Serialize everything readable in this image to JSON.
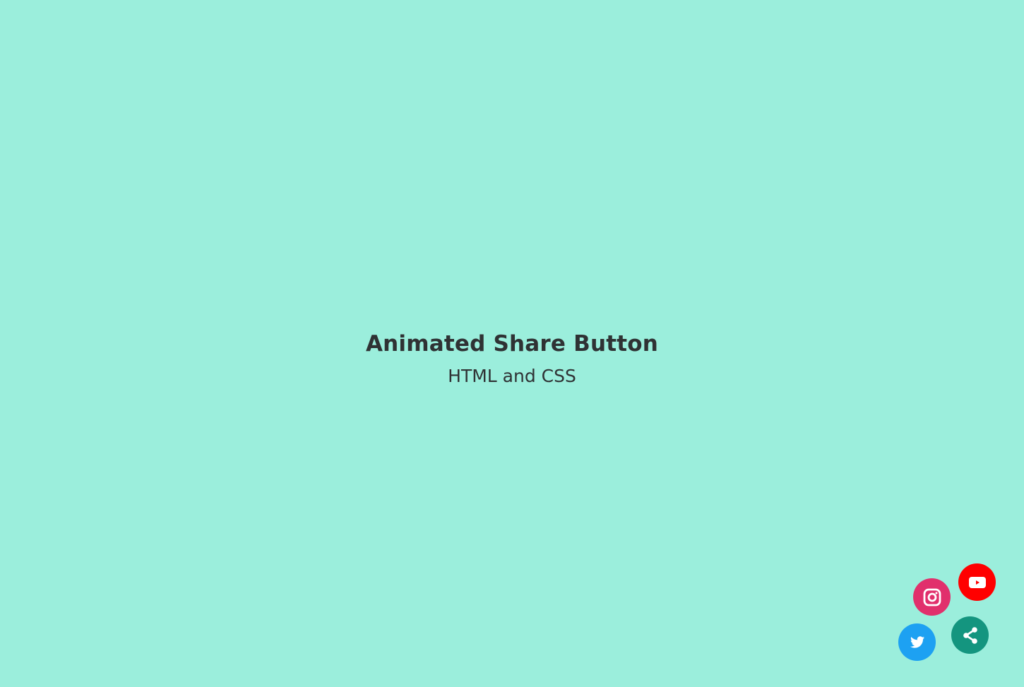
{
  "heading": {
    "title": "Animated Share Button",
    "subtitle": "HTML and CSS"
  },
  "share_menu": {
    "buttons": [
      {
        "id": "youtube",
        "icon": "youtube-icon",
        "color": "#ff0000"
      },
      {
        "id": "instagram",
        "icon": "instagram-icon",
        "color": "#e1306c"
      },
      {
        "id": "twitter",
        "icon": "twitter-icon",
        "color": "#1da1f2"
      },
      {
        "id": "share",
        "icon": "share-icon",
        "color": "#14957f"
      }
    ]
  },
  "colors": {
    "background": "#9beedc",
    "text": "#2f3234",
    "icon": "#ffffff"
  }
}
